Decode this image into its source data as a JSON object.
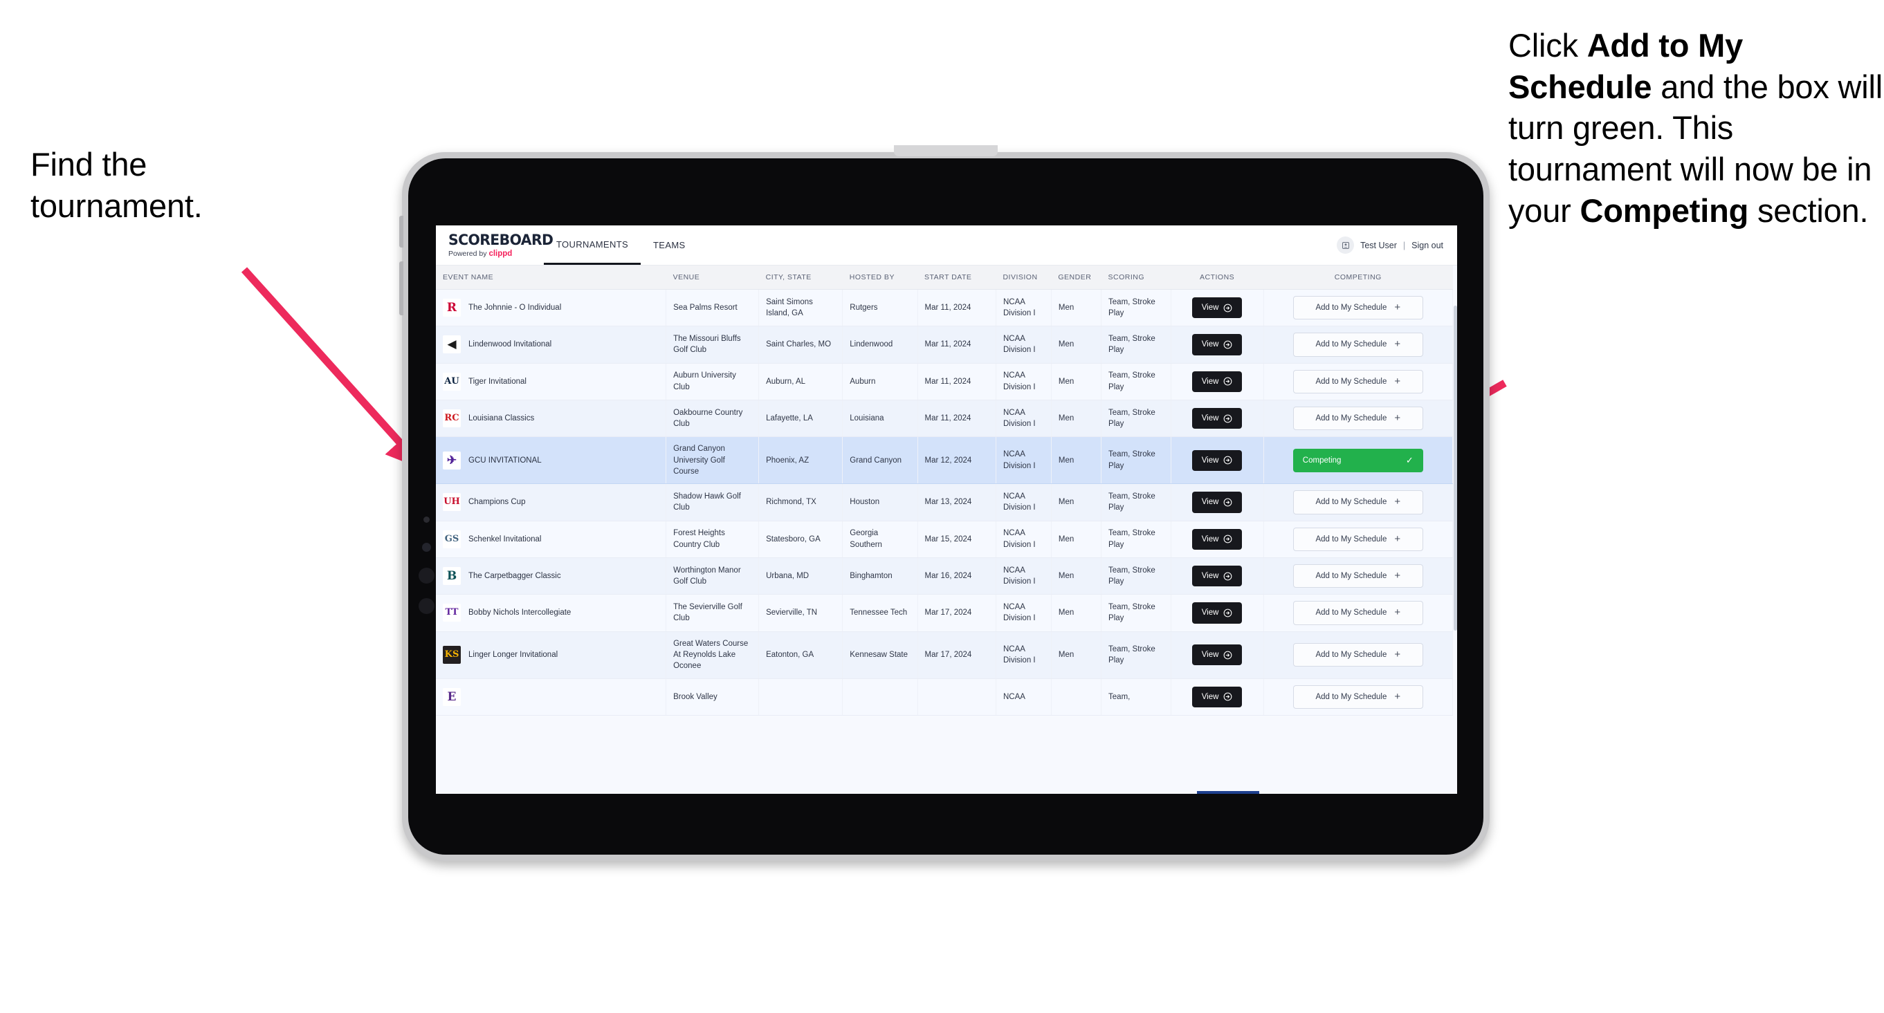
{
  "annotations": {
    "left": {
      "line1": "Find the",
      "line2": "tournament."
    },
    "right": {
      "seg1": "Click ",
      "bold1": "Add to My Schedule",
      "seg2": " and the box will turn green. This tournament will now be in your ",
      "bold2": "Competing",
      "seg3": " section."
    },
    "arrow_color": "#ED2A5C"
  },
  "app": {
    "brand": {
      "title": "SCOREBOARD",
      "powered_prefix": "Powered by",
      "powered_brand": "clippd"
    },
    "nav": {
      "tabs": [
        {
          "label": "TOURNAMENTS",
          "active": true
        },
        {
          "label": "TEAMS",
          "active": false
        }
      ]
    },
    "user": {
      "name": "Test User",
      "separator": "|",
      "signout": "Sign out"
    },
    "table": {
      "columns": [
        "EVENT NAME",
        "VENUE",
        "CITY, STATE",
        "HOSTED BY",
        "START DATE",
        "DIVISION",
        "GENDER",
        "SCORING",
        "ACTIONS",
        "COMPETING"
      ],
      "view_label": "View",
      "add_label": "Add to My Schedule",
      "add_plus": "+",
      "competing_label": "Competing",
      "competing_check": "✓",
      "competing_color": "#22B14C",
      "rows": [
        {
          "event": "The Johnnie - O Individual",
          "venue": "Sea Palms Resort",
          "city": "Saint Simons Island, GA",
          "hosted_by": "Rutgers",
          "start_date": "Mar 11, 2024",
          "division": "NCAA Division I",
          "gender": "Men",
          "scoring": "Team, Stroke Play",
          "competing": false,
          "logo_text": "R",
          "logo_fg": "#CC0033",
          "logo_bg": "#FFFFFF"
        },
        {
          "event": "Lindenwood Invitational",
          "venue": "The Missouri Bluffs Golf Club",
          "city": "Saint Charles, MO",
          "hosted_by": "Lindenwood",
          "start_date": "Mar 11, 2024",
          "division": "NCAA Division I",
          "gender": "Men",
          "scoring": "Team, Stroke Play",
          "competing": false,
          "logo_text": "◀",
          "logo_fg": "#1C1C1C",
          "logo_bg": "#FFFFFF"
        },
        {
          "event": "Tiger Invitational",
          "venue": "Auburn University Club",
          "city": "Auburn, AL",
          "hosted_by": "Auburn",
          "start_date": "Mar 11, 2024",
          "division": "NCAA Division I",
          "gender": "Men",
          "scoring": "Team, Stroke Play",
          "competing": false,
          "logo_text": "AU",
          "logo_fg": "#0C2340",
          "logo_bg": "#FFFFFF"
        },
        {
          "event": "Louisiana Classics",
          "venue": "Oakbourne Country Club",
          "city": "Lafayette, LA",
          "hosted_by": "Louisiana",
          "start_date": "Mar 11, 2024",
          "division": "NCAA Division I",
          "gender": "Men",
          "scoring": "Team, Stroke Play",
          "competing": false,
          "logo_text": "RC",
          "logo_fg": "#CE181E",
          "logo_bg": "#FFFFFF"
        },
        {
          "event": "GCU INVITATIONAL",
          "venue": "Grand Canyon University Golf Course",
          "city": "Phoenix, AZ",
          "hosted_by": "Grand Canyon",
          "start_date": "Mar 12, 2024",
          "division": "NCAA Division I",
          "gender": "Men",
          "scoring": "Team, Stroke Play",
          "competing": true,
          "selected": true,
          "logo_text": "✈",
          "logo_fg": "#522398",
          "logo_bg": "#FFFFFF"
        },
        {
          "event": "Champions Cup",
          "venue": "Shadow Hawk Golf Club",
          "city": "Richmond, TX",
          "hosted_by": "Houston",
          "start_date": "Mar 13, 2024",
          "division": "NCAA Division I",
          "gender": "Men",
          "scoring": "Team, Stroke Play",
          "competing": false,
          "logo_text": "UH",
          "logo_fg": "#C8102E",
          "logo_bg": "#FFFFFF"
        },
        {
          "event": "Schenkel Invitational",
          "venue": "Forest Heights Country Club",
          "city": "Statesboro, GA",
          "hosted_by": "Georgia Southern",
          "start_date": "Mar 15, 2024",
          "division": "NCAA Division I",
          "gender": "Men",
          "scoring": "Team, Stroke Play",
          "competing": false,
          "logo_text": "GS",
          "logo_fg": "#41627E",
          "logo_bg": "#FFFFFF"
        },
        {
          "event": "The Carpetbagger Classic",
          "venue": "Worthington Manor Golf Club",
          "city": "Urbana, MD",
          "hosted_by": "Binghamton",
          "start_date": "Mar 16, 2024",
          "division": "NCAA Division I",
          "gender": "Men",
          "scoring": "Team, Stroke Play",
          "competing": false,
          "logo_text": "B",
          "logo_fg": "#0D5257",
          "logo_bg": "#FFFFFF"
        },
        {
          "event": "Bobby Nichols Intercollegiate",
          "venue": "The Sevierville Golf Club",
          "city": "Sevierville, TN",
          "hosted_by": "Tennessee Tech",
          "start_date": "Mar 17, 2024",
          "division": "NCAA Division I",
          "gender": "Men",
          "scoring": "Team, Stroke Play",
          "competing": false,
          "logo_text": "TT",
          "logo_fg": "#61259E",
          "logo_bg": "#FFFFFF"
        },
        {
          "event": "Linger Longer Invitational",
          "venue": "Great Waters Course At Reynolds Lake Oconee",
          "city": "Eatonton, GA",
          "hosted_by": "Kennesaw State",
          "start_date": "Mar 17, 2024",
          "division": "NCAA Division I",
          "gender": "Men",
          "scoring": "Team, Stroke Play",
          "competing": false,
          "logo_text": "KS",
          "logo_fg": "#F6B300",
          "logo_bg": "#231F20"
        },
        {
          "event": "",
          "venue": "Brook Valley",
          "city": "",
          "hosted_by": "",
          "start_date": "",
          "division": "NCAA",
          "gender": "",
          "scoring": "Team,",
          "competing": false,
          "logo_text": "E",
          "logo_fg": "#592A8A",
          "logo_bg": "#FFFFFF",
          "clipped": true
        }
      ]
    }
  }
}
